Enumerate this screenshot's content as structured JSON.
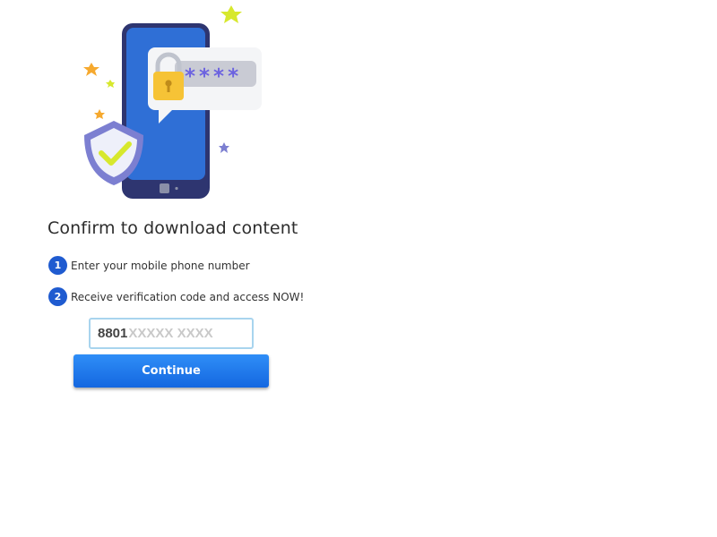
{
  "hero": {
    "illustration_icon": "phone-lock-shield-icon",
    "password_mask": "****",
    "colors": {
      "phone": "#2f6fd6",
      "lock": "#f6c336",
      "shield": "#7c7fd1",
      "check": "#d7e82d",
      "star": "#f6a92e"
    }
  },
  "title": "Confirm to download content",
  "steps": [
    {
      "number": "1",
      "label": "Enter your mobile phone number"
    },
    {
      "number": "2",
      "label": "Receive verification code and access NOW!"
    }
  ],
  "phone": {
    "prefix": "8801",
    "value": "",
    "placeholder": "XXXXX XXXX",
    "border_color": "#a8d4ee"
  },
  "continue_button": {
    "label": "Continue",
    "color": "#1f75ea"
  },
  "accent_color": "#1f5bd0"
}
